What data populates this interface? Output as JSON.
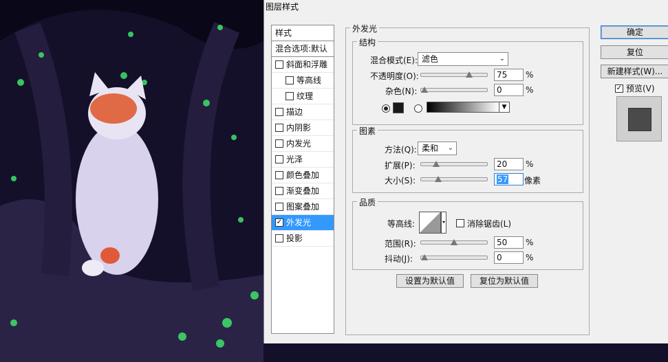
{
  "dialog_title": "图层样式",
  "styles_header": "样式",
  "blend_options": "混合选项:默认",
  "style_items": [
    {
      "label": "斜面和浮雕",
      "checked": false,
      "sub": false,
      "selected": false
    },
    {
      "label": "等高线",
      "checked": false,
      "sub": true,
      "selected": false
    },
    {
      "label": "纹理",
      "checked": false,
      "sub": true,
      "selected": false
    },
    {
      "label": "描边",
      "checked": false,
      "sub": false,
      "selected": false
    },
    {
      "label": "内阴影",
      "checked": false,
      "sub": false,
      "selected": false
    },
    {
      "label": "内发光",
      "checked": false,
      "sub": false,
      "selected": false
    },
    {
      "label": "光泽",
      "checked": false,
      "sub": false,
      "selected": false
    },
    {
      "label": "颜色叠加",
      "checked": false,
      "sub": false,
      "selected": false
    },
    {
      "label": "渐变叠加",
      "checked": false,
      "sub": false,
      "selected": false
    },
    {
      "label": "图案叠加",
      "checked": false,
      "sub": false,
      "selected": false
    },
    {
      "label": "外发光",
      "checked": true,
      "sub": false,
      "selected": true
    },
    {
      "label": "投影",
      "checked": false,
      "sub": false,
      "selected": false
    }
  ],
  "panel_title": "外发光",
  "structure": {
    "title": "结构",
    "blend_mode_label": "混合模式(E):",
    "blend_mode_value": "滤色",
    "opacity_label": "不透明度(O):",
    "opacity_value": "75",
    "opacity_fraction": 0.75,
    "noise_label": "杂色(N):",
    "noise_value": "0",
    "noise_fraction": 0.0,
    "pct": "%",
    "glow_color": "#1a1a1a"
  },
  "elements": {
    "title": "图素",
    "technique_label": "方法(Q):",
    "technique_value": "柔和",
    "spread_label": "扩展(P):",
    "spread_value": "20",
    "spread_fraction": 0.2,
    "size_label": "大小(S):",
    "size_value": "57",
    "size_fraction": 0.23,
    "size_unit": "像素"
  },
  "quality": {
    "title": "品质",
    "contour_label": "等高线:",
    "antialias_label": "消除锯齿(L)",
    "range_label": "范围(R):",
    "range_value": "50",
    "range_fraction": 0.5,
    "jitter_label": "抖动(J):",
    "jitter_value": "0",
    "jitter_fraction": 0.0
  },
  "buttons": {
    "make_default": "设置为默认值",
    "reset_default": "复位为默认值",
    "ok": "确定",
    "reset": "复位",
    "new_style": "新建样式(W)...",
    "preview": "预览(V)"
  }
}
